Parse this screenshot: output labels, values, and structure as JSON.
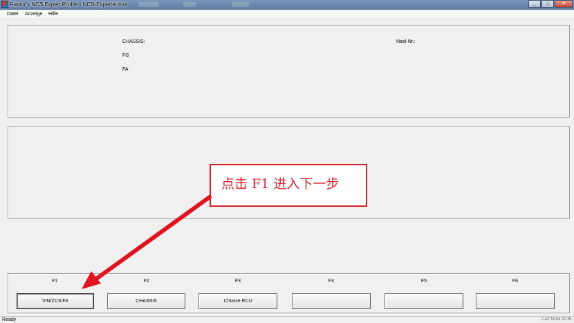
{
  "window": {
    "title": "Revtor's NCS Expert Profile - NCS-Expertentool",
    "minimize_glyph": "_",
    "maximize_glyph": "□",
    "close_glyph": "✕"
  },
  "menu": [
    "Datei",
    "Anzeige",
    "Hilfe"
  ],
  "info_panel": {
    "chassis_label": "CHASSIS:",
    "fg_label": "FG",
    "fa_label": "FA",
    "nael_label": "Nael-Nr.:"
  },
  "function_keys": [
    {
      "key": "F1",
      "label": "VIN/ZCS/FA"
    },
    {
      "key": "F2",
      "label": "CHASSIS"
    },
    {
      "key": "F3",
      "label": "Choose ECU"
    },
    {
      "key": "F4",
      "label": ""
    },
    {
      "key": "F5",
      "label": ""
    },
    {
      "key": "F6",
      "label": ""
    }
  ],
  "status": {
    "left": "Ready",
    "right": "CAP NUM SCRL"
  },
  "annotation": {
    "text": "点击 F1 进入下一步",
    "color": "#d2232a"
  },
  "icons": {
    "app": "app-icon",
    "arrow": "red-arrow-icon"
  }
}
